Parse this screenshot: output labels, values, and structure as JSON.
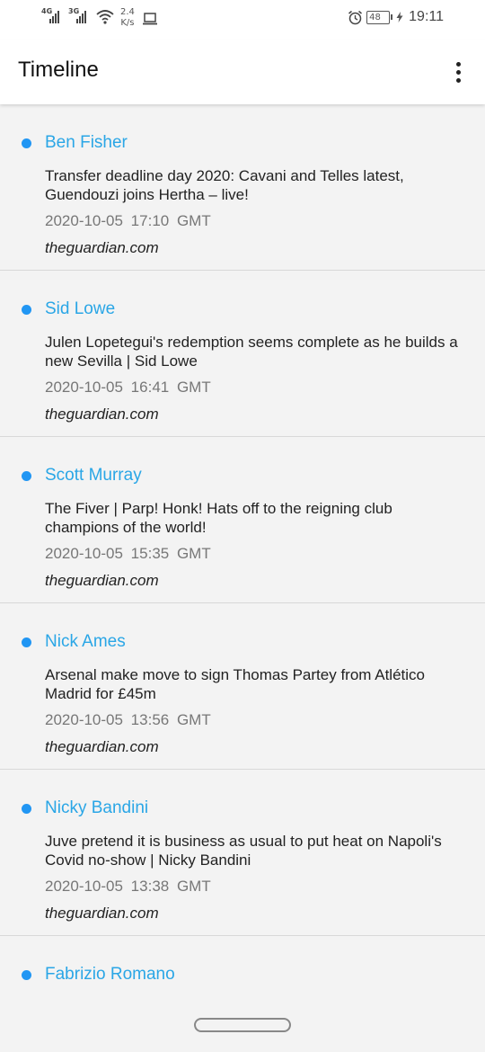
{
  "status_bar": {
    "net1": "4G",
    "net2": "3G",
    "speed_value": "2.4",
    "speed_unit": "K/s",
    "battery": "48",
    "time": "19:11"
  },
  "app_bar": {
    "title": "Timeline",
    "menu_icon": "more-vert-icon"
  },
  "colors": {
    "accent": "#2196f3",
    "author": "#2aa6e6"
  },
  "timeline": [
    {
      "author": "Ben Fisher",
      "headline": "Transfer deadline day 2020: Cavani and Telles latest, Guendouzi joins Hertha – live!",
      "timestamp": "2020-10-05 17:10 GMT",
      "source": "theguardian.com"
    },
    {
      "author": "Sid Lowe",
      "headline": "Julen Lopetegui's redemption seems complete as he builds a new Sevilla | Sid Lowe",
      "timestamp": "2020-10-05 16:41 GMT",
      "source": "theguardian.com"
    },
    {
      "author": "Scott Murray",
      "headline": "The Fiver | Parp! Honk! Hats off to the reigning club champions of the world!",
      "timestamp": "2020-10-05 15:35 GMT",
      "source": "theguardian.com"
    },
    {
      "author": "Nick Ames",
      "headline": "Arsenal make move to sign Thomas Partey from Atlético Madrid for £45m",
      "timestamp": "2020-10-05 13:56 GMT",
      "source": "theguardian.com"
    },
    {
      "author": "Nicky Bandini",
      "headline": "Juve pretend it is business as usual to put heat on Napoli's Covid no-show | Nicky Bandini",
      "timestamp": "2020-10-05 13:38 GMT",
      "source": "theguardian.com"
    },
    {
      "author": "Fabrizio Romano",
      "headline": "",
      "timestamp": "",
      "source": ""
    }
  ]
}
